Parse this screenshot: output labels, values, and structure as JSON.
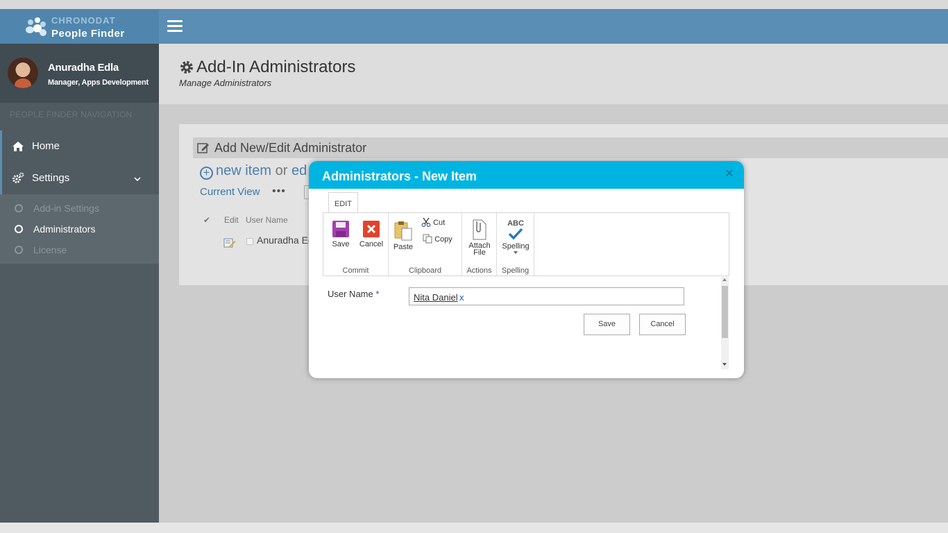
{
  "brand": {
    "line1": "CHRONODAT",
    "line2": "People Finder"
  },
  "profile": {
    "name": "Anuradha Edla",
    "role": "Manager, Apps Development"
  },
  "nav": {
    "heading": "PEOPLE FINDER NAVIGATION",
    "home_label": "Home",
    "settings_label": "Settings",
    "subitems": [
      {
        "label": "Add-in Settings",
        "active": false
      },
      {
        "label": "Administrators",
        "active": true
      },
      {
        "label": "License",
        "active": false
      }
    ]
  },
  "header": {
    "title": "Add-In Administrators",
    "subtitle": "Manage Administrators"
  },
  "panel": {
    "title": "Add New/Edit Administrator",
    "new_item": "new item",
    "or_text": "or",
    "edit_partial": "ed",
    "current_view": "Current View",
    "more": "•••",
    "col_check": "✔",
    "col_edit": "Edit",
    "col_user": "User Name",
    "row_user": "Anuradha Ed"
  },
  "dialog": {
    "title": "Administrators - New Item",
    "close": "✕",
    "ribbon_tab": "EDIT",
    "groups": {
      "commit": {
        "label": "Commit",
        "save": "Save",
        "cancel": "Cancel"
      },
      "clipboard": {
        "label": "Clipboard",
        "paste": "Paste",
        "cut": "Cut",
        "copy": "Copy"
      },
      "actions": {
        "label": "Actions",
        "attach_line1": "Attach",
        "attach_line2": "File"
      },
      "spelling": {
        "label": "Spelling",
        "button": "Spelling",
        "abc": "ABC"
      }
    },
    "field_label": "User Name",
    "required_mark": "*",
    "field_value": "Nita Daniel",
    "field_remove": "x",
    "save_button": "Save",
    "cancel_button": "Cancel"
  },
  "colors": {
    "topbar": "#5a8eb4",
    "sidebar": "#505a61",
    "dialog_header": "#00b4e2",
    "link_blue": "#4c7fb0"
  }
}
